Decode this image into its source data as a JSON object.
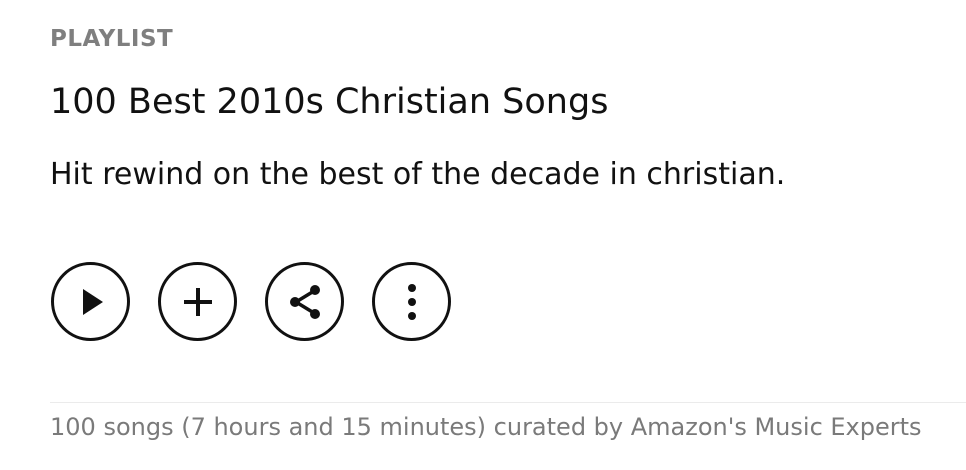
{
  "header": {
    "eyebrow": "PLAYLIST",
    "title": "100 Best 2010s Christian Songs",
    "description": "Hit rewind on the best of the decade in christian."
  },
  "actions": {
    "items": [
      {
        "icon": "play-icon"
      },
      {
        "icon": "plus-icon"
      },
      {
        "icon": "share-icon"
      },
      {
        "icon": "more-vertical-icon"
      }
    ]
  },
  "footer": {
    "meta": "100 songs (7 hours and 15 minutes) curated by Amazon's Music Experts"
  },
  "colors": {
    "text": "#111111",
    "muted": "#7a7a7a",
    "divider": "#ebebeb",
    "background": "#ffffff"
  }
}
